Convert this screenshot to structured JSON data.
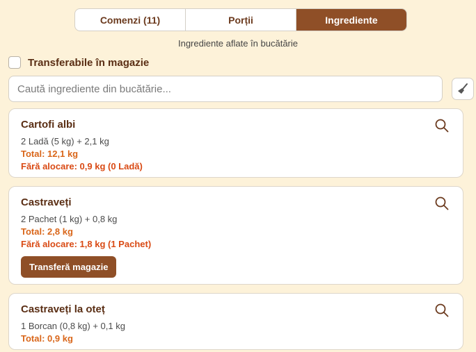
{
  "tabs": [
    {
      "label": "Comenzi (11)",
      "active": false
    },
    {
      "label": "Porții",
      "active": false
    },
    {
      "label": "Ingrediente",
      "active": true
    }
  ],
  "subtitle": "Ingrediente aflate în bucătărie",
  "filter": {
    "label": "Transferabile în magazie",
    "checked": false
  },
  "search": {
    "placeholder": "Caută ingrediente din bucătărie..."
  },
  "clear_icon": "broom-icon",
  "colors": {
    "accent": "#8f4f27",
    "total": "#d9661a",
    "warning": "#d94a14",
    "background": "#fdf2d9"
  },
  "ingredients": [
    {
      "name": "Cartofi albi",
      "quantity": "2 Ladă (5 kg) + 2,1 kg",
      "total": "Total: 12,1 kg",
      "unallocated": "Fără alocare: 0,9 kg (0 Ladă)"
    },
    {
      "name": "Castraveți",
      "quantity": "2 Pachet (1 kg) + 0,8 kg",
      "total": "Total: 2,8 kg",
      "unallocated": "Fără alocare: 1,8 kg (1 Pachet)",
      "action": "Transferă magazie"
    },
    {
      "name": "Castraveți la oteț",
      "quantity": "1 Borcan (0,8 kg) + 0,1 kg",
      "total": "Total: 0,9 kg"
    }
  ]
}
